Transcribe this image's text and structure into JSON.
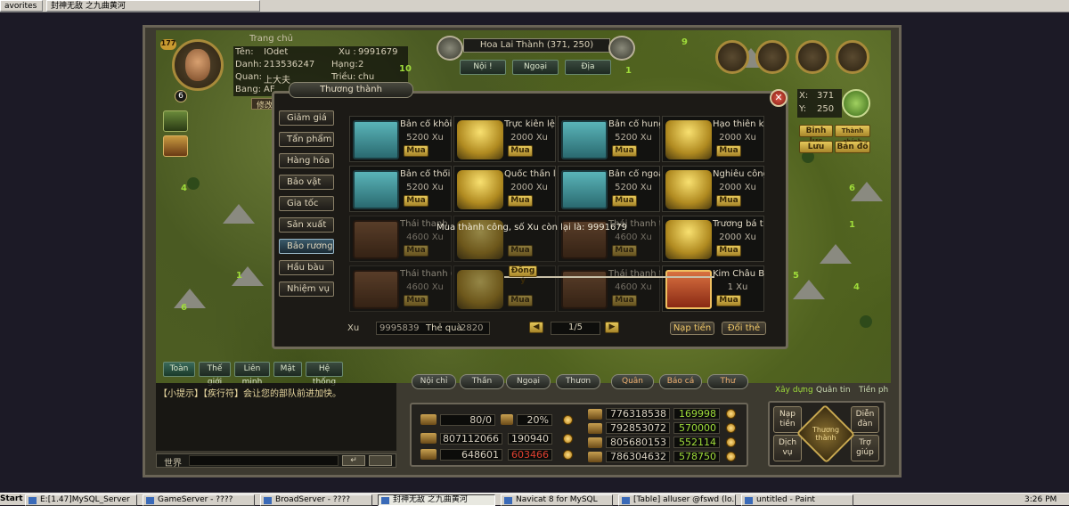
{
  "browser": {
    "tab1": "avorites",
    "tab2": "封神无敌 之九曲黄河"
  },
  "hud": {
    "level_badge": "177",
    "menu_link": "Trang chủ",
    "avatar_level": "6",
    "name_label": "Tên:",
    "name_value": "IOdet",
    "xu_label": "Xu :",
    "xu_value": "9991679",
    "danh_label": "Danh:",
    "danh_value": "213536247",
    "hang_label": "Hạng:",
    "hang_value": "2",
    "quan_label": "Quan:",
    "quan_value": "上大夫",
    "trieu_label": "Triều:",
    "trieu_value": "chu",
    "bang_label": "Bang:",
    "bang_value": "AF",
    "panel_title": "Thương thành",
    "side_tag": "修改",
    "map_badge": "10"
  },
  "location": {
    "name": "Hoa Lai Thành (371, 250)",
    "tabs": [
      "Nội !",
      "Ngoại",
      "Địa"
    ]
  },
  "minimap": {
    "x_label": "X:",
    "x_value": "371",
    "y_label": "Y:",
    "y_value": "250",
    "buttons": [
      "Binh lực",
      "Thành chính",
      "Lưu",
      "Bản đồ"
    ]
  },
  "shop": {
    "categories": [
      "Giảm giá",
      "Tẩn phẩm",
      "Hàng hóa",
      "Bảo vật",
      "Gia tốc",
      "Sản xuất",
      "Bảo rương",
      "Hầu bàu",
      "Nhiệm vụ"
    ],
    "selected_category": "Bảo rương",
    "items": [
      {
        "name": "Bản cổ khôi",
        "price": "5200 Xu",
        "buy": "Mua",
        "kind": "teal",
        "dim": false
      },
      {
        "name": "Trực kiên lệ",
        "price": "2000 Xu",
        "buy": "Mua",
        "kind": "gold",
        "dim": false
      },
      {
        "name": "Bản cổ hung",
        "price": "5200 Xu",
        "buy": "Mua",
        "kind": "teal",
        "dim": false
      },
      {
        "name": "Hạo thiên kh",
        "price": "2000 Xu",
        "buy": "Mua",
        "kind": "gold",
        "dim": false
      },
      {
        "name": "Bản cổ thổi",
        "price": "5200 Xu",
        "buy": "Mua",
        "kind": "teal",
        "dim": false
      },
      {
        "name": "Quốc thần lệ",
        "price": "2000 Xu",
        "buy": "Mua",
        "kind": "gold",
        "dim": false
      },
      {
        "name": "Bản cổ ngoa",
        "price": "5200 Xu",
        "buy": "Mua",
        "kind": "teal",
        "dim": false
      },
      {
        "name": "Nghiêu công",
        "price": "2000 Xu",
        "buy": "Mua",
        "kind": "gold",
        "dim": false
      },
      {
        "name": "Thái thanh",
        "price": "4600 Xu",
        "buy": "Mua",
        "kind": "brown",
        "dim": true
      },
      {
        "name": "",
        "price": "",
        "buy": "Mua",
        "kind": "gold",
        "dim": true
      },
      {
        "name": "Thái thanh t",
        "price": "4600 Xu",
        "buy": "Mua",
        "kind": "brown",
        "dim": true
      },
      {
        "name": "Trương bá t",
        "price": "2000 Xu",
        "buy": "Mua",
        "kind": "gold",
        "dim": false
      },
      {
        "name": "Thái thanh (",
        "price": "4600 Xu",
        "buy": "Mua",
        "kind": "brown",
        "dim": true
      },
      {
        "name": "",
        "price": "",
        "buy": "Mua",
        "kind": "gold",
        "dim": true
      },
      {
        "name": "Thái thanh t",
        "price": "4600 Xu",
        "buy": "Mua",
        "kind": "brown",
        "dim": true
      },
      {
        "name": "Kim Châu B",
        "price": "1 Xu",
        "buy": "Mua",
        "kind": "red",
        "dim": false
      }
    ],
    "footer": {
      "xu_label": "Xu",
      "xu_value": "9995839",
      "gift_label": "Thẻ quà",
      "gift_value": "2820",
      "page": "1/5",
      "topup": "Nạp tiền",
      "exchange": "Đổi thẻ"
    },
    "message": "Mua thành công, số Xu còn lại là: 9991679",
    "confirm": "Đồng ý"
  },
  "chat": {
    "tabs": [
      "Toàn",
      "Thế giới",
      "Liên minh",
      "Mật",
      "Hệ thống"
    ],
    "line": "【小提示】【疾行符】会让您的部队前进加快。",
    "input_label": "世界"
  },
  "bottom_tabs": [
    "Nội chỉ",
    "Thần",
    "Ngoại",
    "Thươn",
    "Quân",
    "Báo cá",
    "Thư"
  ],
  "right_tabs": [
    "Xây dựng",
    "Quân tin",
    "Tiền ph"
  ],
  "resources": {
    "food": "80/0",
    "pct": "20%",
    "r1": "807112066",
    "r2": "190940",
    "r3": "648601",
    "r4": "603466",
    "col_a": [
      "776318538",
      "792853072",
      "805680153",
      "786304632"
    ],
    "col_b": [
      "169998",
      "570000",
      "552114",
      "578750"
    ]
  },
  "action_buttons": {
    "topup": "Nạp tiền",
    "capital": "Diễn đàn",
    "service": "Dịch vụ",
    "help": "Trợ giúp",
    "center": "Thương thành"
  },
  "taskbar": {
    "start": "Start",
    "items": [
      "E:[1.47]MySQL_Server",
      "GameServer - ????",
      "BroadServer - ????",
      "封神无敌 之九曲黄河",
      "Navicat 8 for MySQL",
      "[Table] alluser @fswd (lo...",
      "untitled - Paint"
    ],
    "clock": "3:26 PM"
  }
}
